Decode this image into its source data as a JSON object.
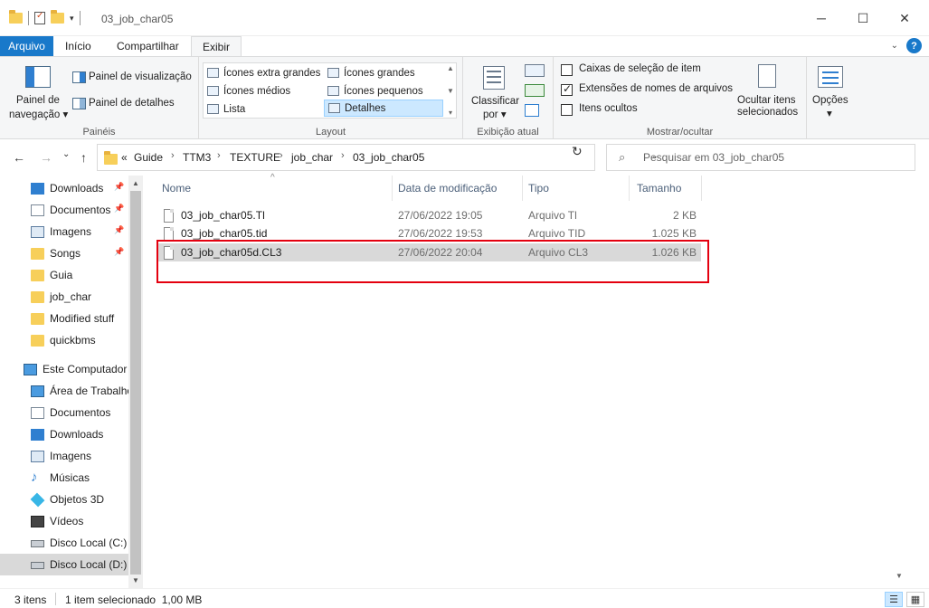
{
  "window": {
    "title": "03_job_char05",
    "minimize": "─",
    "maximize": "☐",
    "close": "✕"
  },
  "menu": {
    "arquivo": "Arquivo",
    "inicio": "Início",
    "compartilhar": "Compartilhar",
    "exibir": "Exibir",
    "help": "?"
  },
  "ribbon": {
    "paineis": {
      "label": "Painéis",
      "painel_navegacao_line1": "Painel de",
      "painel_navegacao_line2": "navegação ▾",
      "painel_visualizacao": "Painel de visualização",
      "painel_detalhes": "Painel de detalhes"
    },
    "layout": {
      "label": "Layout",
      "icones_extra_grandes": "Ícones extra grandes",
      "icones_grandes": "Ícones grandes",
      "icones_medios": "Ícones médios",
      "icones_pequenos": "Ícones pequenos",
      "lista": "Lista",
      "detalhes": "Detalhes"
    },
    "exibicao_atual": {
      "label": "Exibição atual",
      "classificar_line1": "Classificar",
      "classificar_line2": "por ▾"
    },
    "mostrar_ocultar": {
      "label": "Mostrar/ocultar",
      "caixas_selecao": "Caixas de seleção de item",
      "extensoes": "Extensões de nomes de arquivos",
      "itens_ocultos": "Itens ocultos",
      "ocultar_line1": "Ocultar itens",
      "ocultar_line2": "selecionados",
      "caixas_selecao_checked": false,
      "extensoes_checked": true,
      "itens_ocultos_checked": false
    },
    "opcoes": {
      "label": "Opções",
      "arrow": "▾"
    }
  },
  "address": {
    "back": "←",
    "forward": "→",
    "recent": "⌄",
    "up": "↑",
    "overflow": "«",
    "crumbs": [
      "Guide",
      "TTM3",
      "TEXTURE",
      "job_char",
      "03_job_char05"
    ],
    "sep": "›",
    "dropdown": "⌄",
    "refresh": "↻",
    "search_placeholder": "Pesquisar em 03_job_char05",
    "search_icon": "⌕"
  },
  "navpane": {
    "items": [
      {
        "label": "Downloads",
        "icon": "download-icon",
        "pinned": true
      },
      {
        "label": "Documentos",
        "icon": "documents-icon",
        "pinned": true
      },
      {
        "label": "Imagens",
        "icon": "pictures-icon",
        "pinned": true
      },
      {
        "label": "Songs",
        "icon": "folder-icon",
        "pinned": true
      },
      {
        "label": "Guia",
        "icon": "folder-icon",
        "pinned": false
      },
      {
        "label": "job_char",
        "icon": "folder-icon",
        "pinned": false
      },
      {
        "label": "Modified stuff",
        "icon": "folder-icon",
        "pinned": false
      },
      {
        "label": "quickbms",
        "icon": "folder-icon",
        "pinned": false
      },
      {
        "label": "Este Computador",
        "icon": "computer-icon",
        "pinned": false
      },
      {
        "label": "Área de Trabalho",
        "icon": "desktop-icon",
        "pinned": false
      },
      {
        "label": "Documentos",
        "icon": "documents-icon",
        "pinned": false
      },
      {
        "label": "Downloads",
        "icon": "download-icon",
        "pinned": false
      },
      {
        "label": "Imagens",
        "icon": "pictures-icon",
        "pinned": false
      },
      {
        "label": "Músicas",
        "icon": "music-icon",
        "pinned": false
      },
      {
        "label": "Objetos 3D",
        "icon": "3d-objects-icon",
        "pinned": false
      },
      {
        "label": "Vídeos",
        "icon": "videos-icon",
        "pinned": false
      },
      {
        "label": "Disco Local (C:)",
        "icon": "drive-icon",
        "pinned": false
      },
      {
        "label": "Disco Local (D:)",
        "icon": "drive-icon",
        "pinned": false,
        "selected": true
      }
    ],
    "pin_glyph": "📌",
    "scroll_up": "▲",
    "scroll_down": "▼"
  },
  "files": {
    "columns": {
      "name": "Nome",
      "date": "Data de modificação",
      "type": "Tipo",
      "size": "Tamanho"
    },
    "sort_glyph": "^",
    "rows": [
      {
        "name": "03_job_char05.Tl",
        "date": "27/06/2022 19:05",
        "type": "Arquivo Tl",
        "size": "2 KB",
        "selected": false
      },
      {
        "name": "03_job_char05.tid",
        "date": "27/06/2022 19:53",
        "type": "Arquivo TID",
        "size": "1.025 KB",
        "selected": false
      },
      {
        "name": "03_job_char05d.CL3",
        "date": "27/06/2022 20:04",
        "type": "Arquivo CL3",
        "size": "1.026 KB",
        "selected": true
      }
    ],
    "scroll_down": "▼"
  },
  "status": {
    "count": "3 itens",
    "selection": "1 item selecionado  1,00 MB"
  },
  "colors": {
    "accent": "#1979ca",
    "highlight_box": "#e4000f",
    "selection": "#d9d9d9"
  }
}
